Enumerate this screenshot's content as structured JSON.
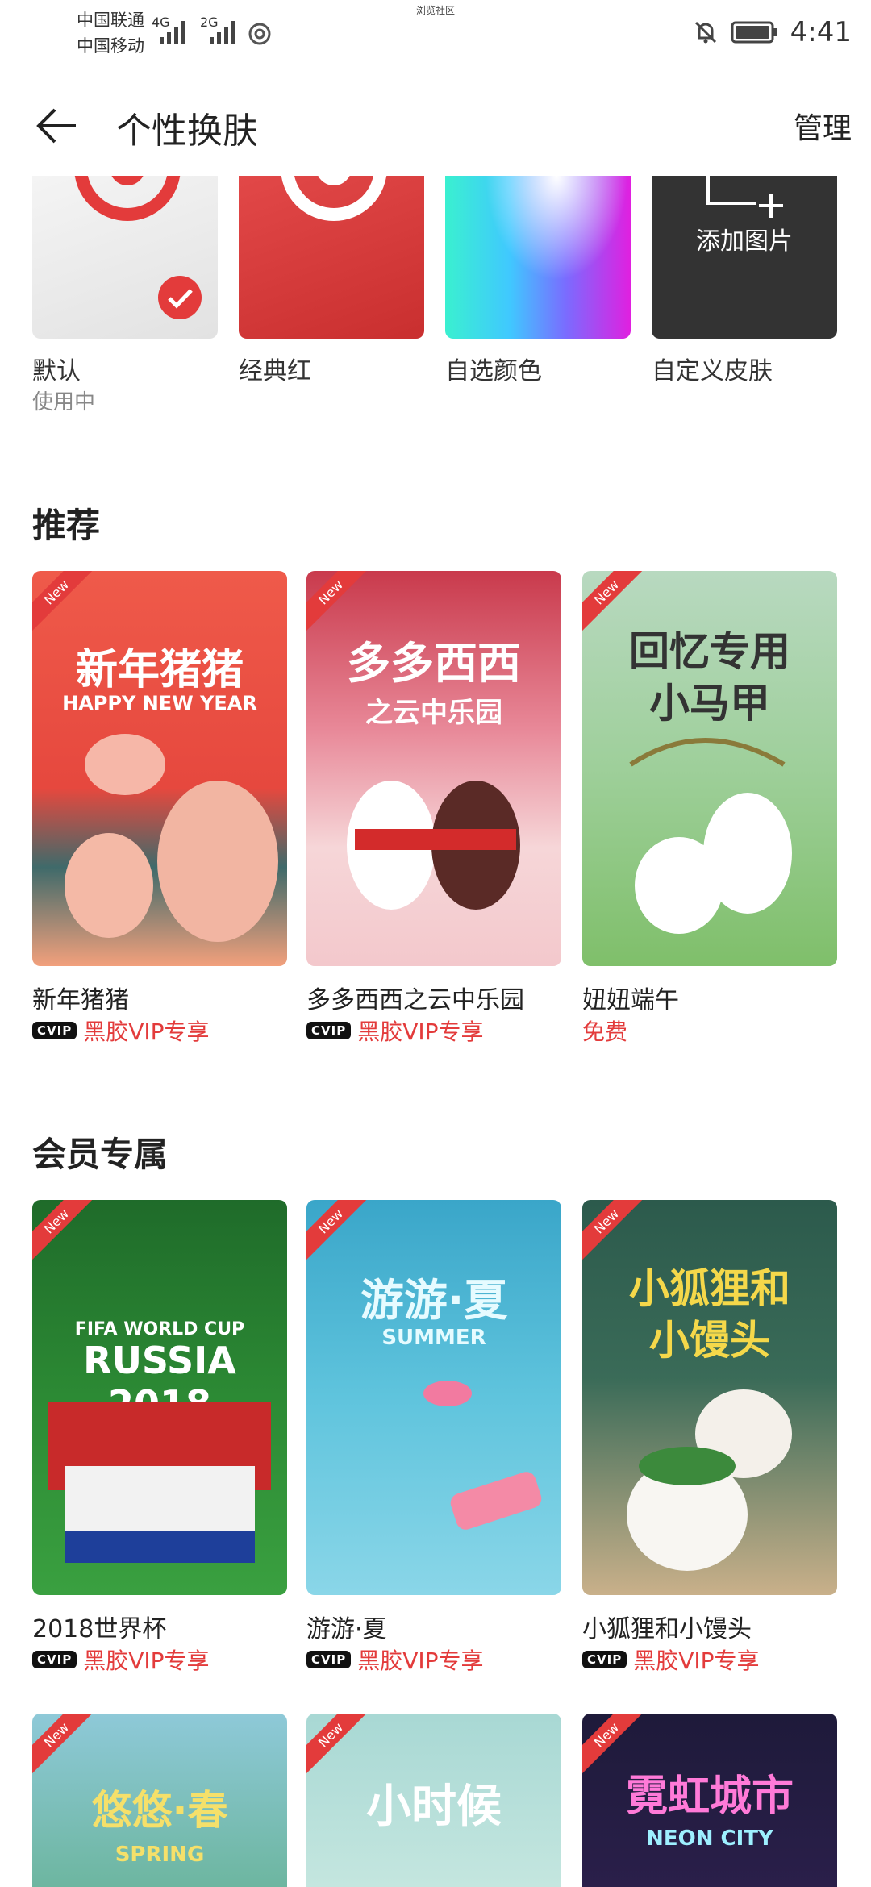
{
  "status_bar": {
    "carrier1": "中国联通",
    "carrier2": "中国移动",
    "net1": "4G",
    "net2": "2G",
    "center_label": "浏览社区",
    "time": "4:41"
  },
  "header": {
    "title": "个性换肤",
    "manage": "管理"
  },
  "skins": [
    {
      "label": "默认",
      "sub": "使用中"
    },
    {
      "label": "经典红"
    },
    {
      "label": "自选颜色"
    },
    {
      "label": "自定义皮肤",
      "tile_text": "添加图片"
    }
  ],
  "sections": {
    "recommend": {
      "title": "推荐",
      "items": [
        {
          "poster_title": "新年猪猪",
          "poster_sub": "HAPPY NEW YEAR",
          "name": "新年猪猪",
          "tag": "黑胶VIP专享",
          "vip": true,
          "badge": "New"
        },
        {
          "poster_title": "多多西西",
          "poster_sub": "之云中乐园",
          "name": "多多西西之云中乐园",
          "tag": "黑胶VIP专享",
          "vip": true,
          "badge": "New"
        },
        {
          "poster_title": "回忆专用",
          "poster_sub": "小马甲",
          "name": "妞妞端午",
          "tag": "免费",
          "vip": false,
          "badge": "New"
        }
      ]
    },
    "member": {
      "title": "会员专属",
      "items": [
        {
          "poster_title": "RUSSIA 2018",
          "poster_sub": "FIFA WORLD CUP",
          "name": "2018世界杯",
          "tag": "黑胶VIP专享",
          "vip": true,
          "badge": "New"
        },
        {
          "poster_title": "游游·夏",
          "poster_sub": "SUMMER",
          "name": "游游·夏",
          "tag": "黑胶VIP专享",
          "vip": true,
          "badge": "New"
        },
        {
          "poster_title": "小狐狸和",
          "poster_sub": "小馒头",
          "name": "小狐狸和小馒头",
          "tag": "黑胶VIP专享",
          "vip": true,
          "badge": "New"
        }
      ]
    },
    "more": {
      "items": [
        {
          "poster_title": "悠悠·春",
          "poster_sub": "SPRING",
          "badge": "New"
        },
        {
          "poster_title": "小时候",
          "badge": "New"
        },
        {
          "poster_title": "霓虹城市",
          "poster_sub": "NEON CITY",
          "badge": "New"
        }
      ]
    }
  },
  "vip_badge_text": "CVIP",
  "colors": {
    "accent": "#e33b3b",
    "dark_tile": "#333333"
  }
}
